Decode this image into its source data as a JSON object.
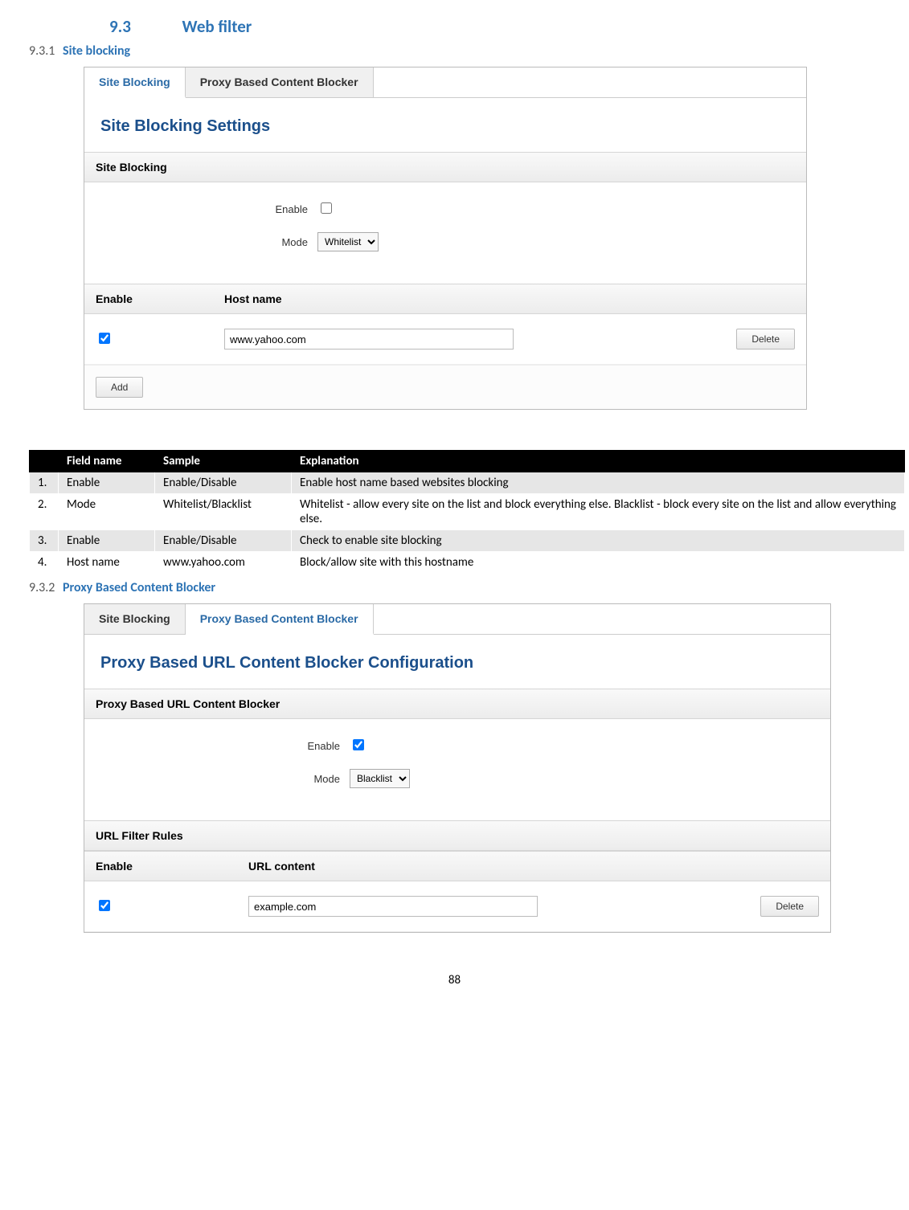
{
  "heading": {
    "section_num": "9.3",
    "section_title": "Web filter",
    "sub1_num": "9.3.1",
    "sub1_title": "Site blocking",
    "sub2_num": "9.3.2",
    "sub2_title": "Proxy Based Content Blocker"
  },
  "panel1": {
    "tab_site_blocking": "Site Blocking",
    "tab_proxy": "Proxy Based Content Blocker",
    "title": "Site Blocking Settings",
    "section_head": "Site Blocking",
    "enable_label": "Enable",
    "mode_label": "Mode",
    "mode_value": "Whitelist",
    "col_enable": "Enable",
    "col_hostname": "Host name",
    "row_hostname_value": "www.yahoo.com",
    "btn_delete": "Delete",
    "btn_add": "Add"
  },
  "explain_table": {
    "head_fieldname": "Field name",
    "head_sample": "Sample",
    "head_explanation": "Explanation",
    "rows": [
      {
        "n": "1.",
        "field": "Enable",
        "sample": "Enable/Disable",
        "exp": "Enable host name based websites blocking"
      },
      {
        "n": "2.",
        "field": "Mode",
        "sample": "Whitelist/Blacklist",
        "exp": "Whitelist - allow every site on the list and block everything else. Blacklist - block every site on the list and allow everything else."
      },
      {
        "n": "3.",
        "field": "Enable",
        "sample": "Enable/Disable",
        "exp": "Check to enable site blocking"
      },
      {
        "n": "4.",
        "field": "Host name",
        "sample": "www.yahoo.com",
        "exp": "Block/allow site with this hostname"
      }
    ]
  },
  "panel2": {
    "tab_site_blocking": "Site Blocking",
    "tab_proxy": "Proxy Based Content Blocker",
    "title": "Proxy Based URL Content Blocker Configuration",
    "section_head": "Proxy Based URL Content Blocker",
    "enable_label": "Enable",
    "mode_label": "Mode",
    "mode_value": "Blacklist",
    "rules_head": "URL Filter Rules",
    "col_enable": "Enable",
    "col_urlcontent": "URL content",
    "row_url_value": "example.com",
    "btn_delete": "Delete"
  },
  "page_number": "88"
}
